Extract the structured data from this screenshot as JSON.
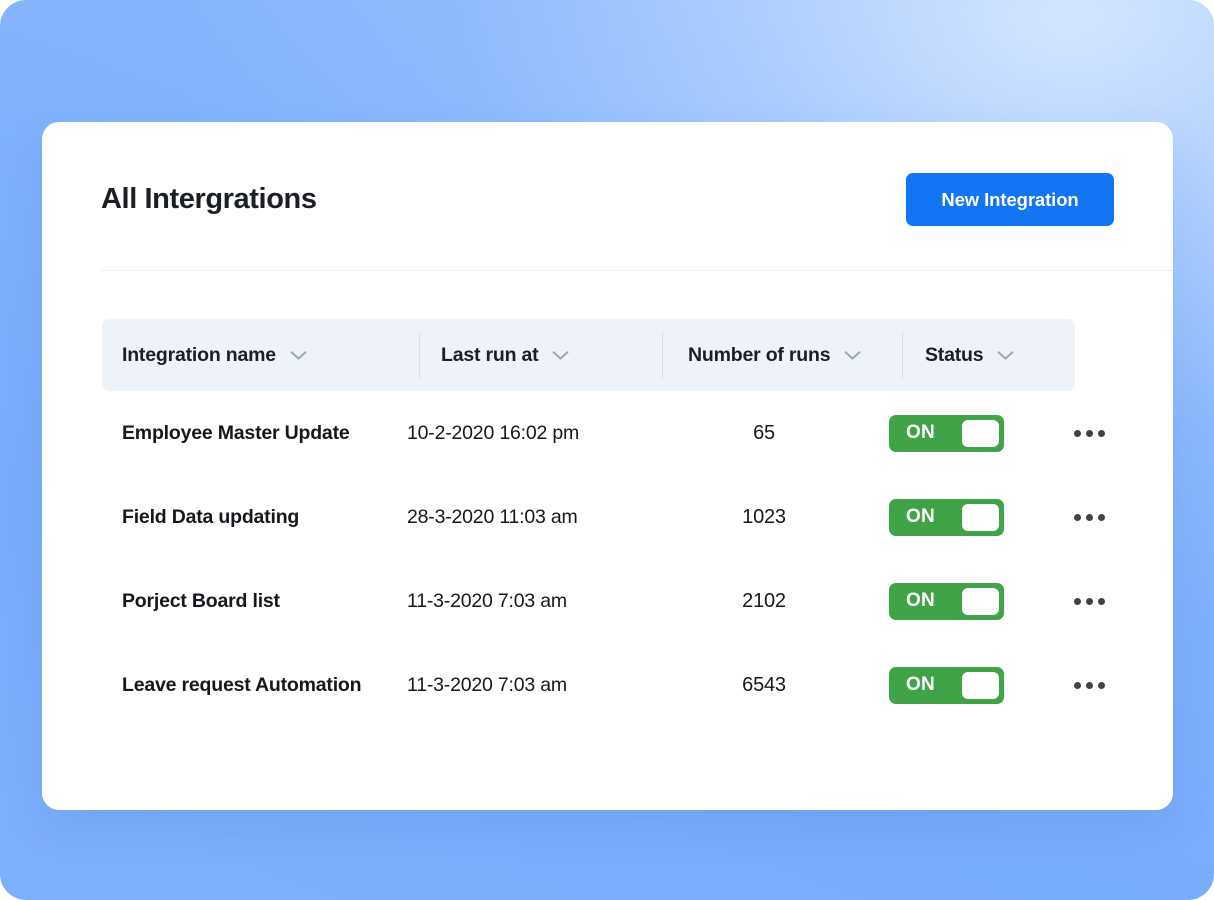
{
  "header": {
    "title": "All Intergrations",
    "new_integration_label": "New Integration",
    "accent_color": "#1275f3"
  },
  "table": {
    "columns": [
      {
        "label": "Integration name",
        "sort_icon": "chevron-down-icon"
      },
      {
        "label": "Last run at",
        "sort_icon": "chevron-down-icon"
      },
      {
        "label": "Number of runs",
        "sort_icon": "chevron-down-icon"
      },
      {
        "label": "Status",
        "sort_icon": "chevron-down-icon"
      }
    ],
    "header_background": "#eef2f9",
    "rows": [
      {
        "name": "Employee Master Update",
        "last_run_at": "10-2-2020 16:02 pm",
        "number_of_runs": "65",
        "status": "ON",
        "menu_icon": "more-horizontal-icon"
      },
      {
        "name": "Field Data updating",
        "last_run_at": "28-3-2020 11:03 am",
        "number_of_runs": "1023",
        "status": "ON",
        "menu_icon": "more-horizontal-icon"
      },
      {
        "name": "Porject Board list",
        "last_run_at": "11-3-2020 7:03 am",
        "number_of_runs": "2102",
        "status": "ON",
        "menu_icon": "more-horizontal-icon"
      },
      {
        "name": "Leave request Automation",
        "last_run_at": "11-3-2020 7:03 am",
        "number_of_runs": "6543",
        "status": "ON",
        "menu_icon": "more-horizontal-icon"
      }
    ],
    "toggle_on_color": "#41a347"
  }
}
